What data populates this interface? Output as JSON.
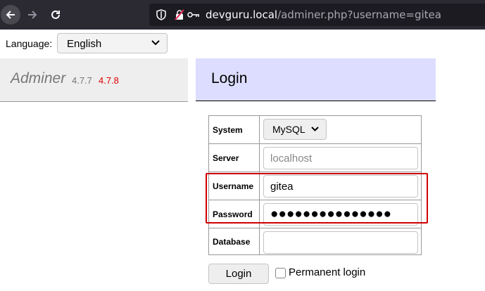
{
  "browser": {
    "url_host": "devguru.local",
    "url_path": "/adminer.php?username=gitea",
    "icons": [
      "back-arrow-icon",
      "forward-arrow-icon",
      "reload-icon",
      "shield-icon",
      "insecure-lock-icon",
      "key-icon"
    ]
  },
  "language": {
    "label": "Language:",
    "selected": "English"
  },
  "app": {
    "name": "Adminer",
    "current_version": "4.7.7",
    "new_version": "4.7.8"
  },
  "page": {
    "title": "Login"
  },
  "form": {
    "system_label": "System",
    "system_value": "MySQL",
    "server_label": "Server",
    "server_placeholder": "localhost",
    "username_label": "Username",
    "username_value": "gitea",
    "password_label": "Password",
    "password_value": "●●●●●●●●●●●●●●●",
    "database_label": "Database",
    "database_value": "",
    "login_button": "Login",
    "permanent_label": "Permanent login"
  },
  "colors": {
    "chrome_bg": "#2b2a33",
    "login_header_bg": "#ddddff",
    "new_version": "#e00000",
    "highlight": "#d00000"
  }
}
